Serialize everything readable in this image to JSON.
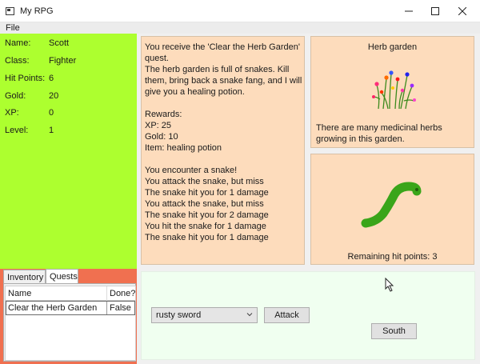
{
  "window": {
    "title": "My RPG",
    "menu": [
      "File"
    ]
  },
  "player": {
    "stats": [
      {
        "label": "Name:",
        "value": "Scott"
      },
      {
        "label": "Class:",
        "value": "Fighter"
      },
      {
        "label": "Hit Points:",
        "value": "6"
      },
      {
        "label": "Gold:",
        "value": "20"
      },
      {
        "label": "XP:",
        "value": "0"
      },
      {
        "label": "Level:",
        "value": "1"
      }
    ]
  },
  "tabs": {
    "items": [
      "Inventory",
      "Quests"
    ],
    "selected": "Quests"
  },
  "quests_grid": {
    "columns": [
      "Name",
      "Done?"
    ],
    "rows": [
      {
        "name": "Clear the Herb Garden",
        "done": "False"
      }
    ]
  },
  "messages": [
    "You receive the 'Clear the Herb Garden'",
    "quest.",
    "The herb garden is full of snakes. Kill",
    "them, bring back a snake fang, and I will",
    "give you a healing potion.",
    "",
    "Rewards:",
    "XP: 25",
    "Gold: 10",
    "Item: healing potion",
    "",
    "You encounter a snake!",
    "You attack the snake, but miss",
    "The snake hit you for 1 damage",
    "You attack the snake, but miss",
    "The snake hit you for 2 damage",
    "You hit the snake for 1 damage",
    "The snake hit you for 1 damage"
  ],
  "location": {
    "name": "Herb garden",
    "description": "There are many medicinal herbs growing in this garden.",
    "image_icon": "herb-garden-icon"
  },
  "monster": {
    "hp_text": "Remaining hit points: 3",
    "image_icon": "snake-icon"
  },
  "controls": {
    "weapon_selected": "rusty sword",
    "attack_label": "Attack",
    "south_label": "South"
  },
  "colors": {
    "stats_panel": "#adff2f",
    "tabs_area": "#f07050",
    "info_boxes": "#fddcbc",
    "controls_panel": "#f0fff0",
    "snake": "#3aa51a"
  }
}
